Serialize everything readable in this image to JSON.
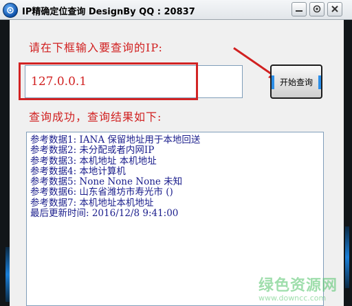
{
  "window": {
    "title": "IP精确定位查询 DesignBy QQ : 20837",
    "buttons": [
      "minimize",
      "settings",
      "close"
    ]
  },
  "form": {
    "prompt_label": "请在下框输入要查询的IP:",
    "ip_value": "127.0.0.1",
    "query_button_label": "开始查询",
    "status_text": "查询成功，查询结果如下:"
  },
  "results": [
    "参考数据1: IANA 保留地址用于本地回送",
    "参考数据2: 未分配或者内网IP",
    "参考数据3: 本机地址 本机地址",
    "参考数据4: 本地计算机",
    "参考数据5: None None None 未知",
    "参考数据6: 山东省潍坊市寿光市 ()",
    "参考数据7: 本机地址本机地址",
    "最后更新时间: 2016/12/8 9:41:00"
  ],
  "watermark": {
    "brand": "绿色资源网",
    "url": "www.downcc.com"
  },
  "colors": {
    "accent_red": "#d12020",
    "result_text": "#1a1d8c",
    "glow_blue": "#1a7fd8",
    "watermark_green": "#52c46a"
  },
  "icons": [
    "app-logo-icon",
    "minimize-icon",
    "settings-icon",
    "close-icon",
    "annotation-arrow"
  ]
}
